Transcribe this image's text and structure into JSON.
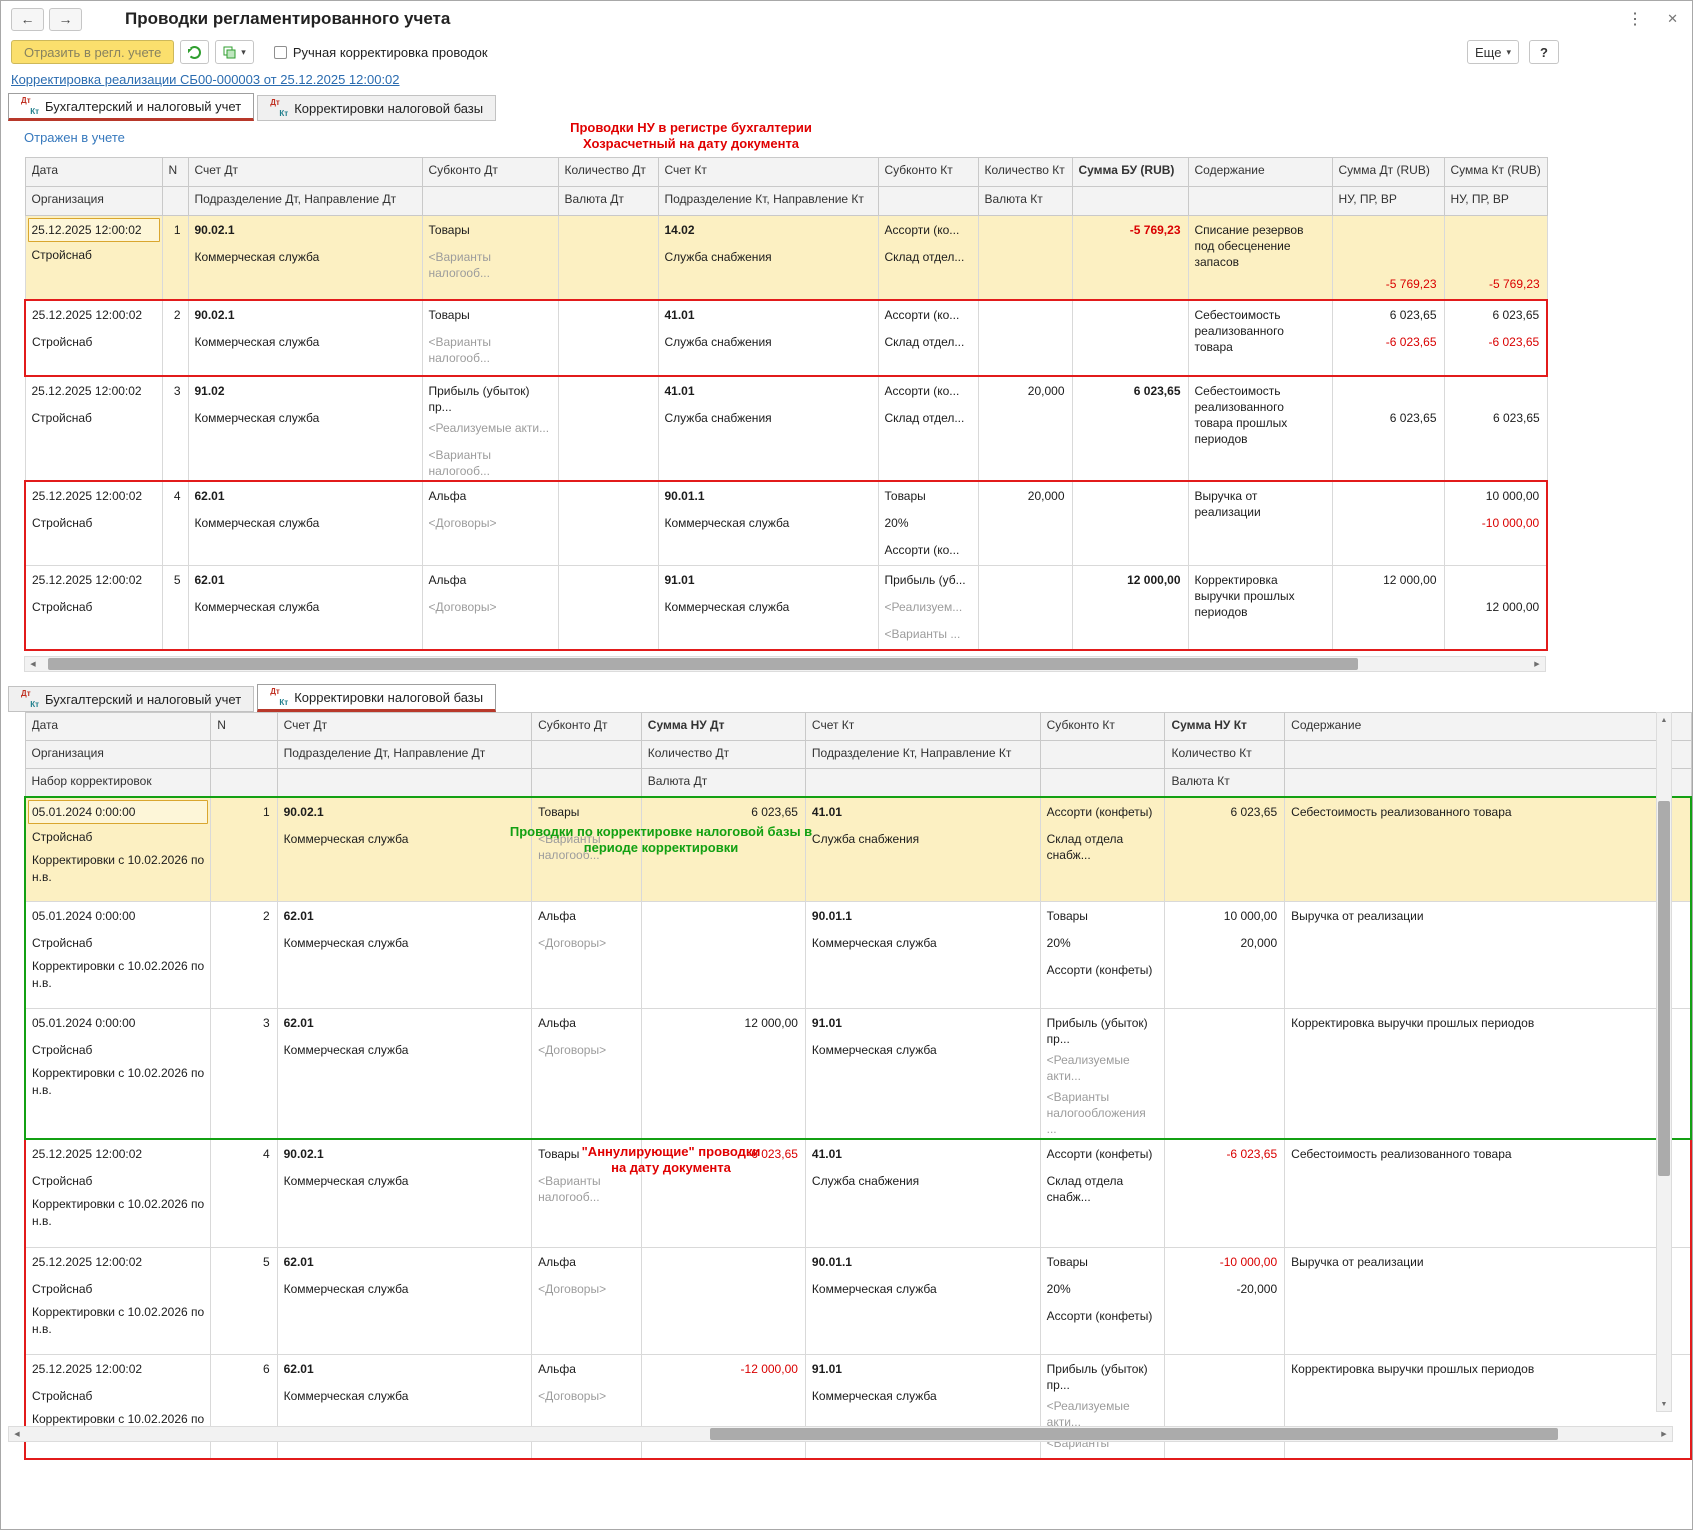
{
  "titlebar": {
    "title": "Проводки регламентированного учета",
    "back": "←",
    "forward": "→"
  },
  "icons": {
    "dots": "⋮",
    "close": "✕",
    "caret": "▾",
    "scroll_left": "◀",
    "scroll_right": "▶",
    "scroll_up": "▲",
    "scroll_down": "▼"
  },
  "toolbar": {
    "reflect_button": "Отразить в регл. учете",
    "manual_correction_label": "Ручная корректировка проводок",
    "manual_correction_checked": false,
    "more_button": "Еще",
    "help_button": "?"
  },
  "document_link": "Корректировка реализации СБ00-000003 от 25.12.2025 12:00:02",
  "status_link": "Отражен в учете",
  "tabs": {
    "bu_nu": "Бухгалтерский и налоговый учет",
    "corrections": "Корректировки налоговой базы"
  },
  "annotations": {
    "top_red_line1": "Проводки НУ в регистре бухгалтерии",
    "top_red_line2": "Хозрасчетный на дату документа",
    "green_line1": "Проводки по корректировке налоговой базы в",
    "green_line2": "периоде корректировки",
    "bottom_red_line1": "\"Аннулирующие\" проводки",
    "bottom_red_line2": "на дату документа"
  },
  "table1": {
    "header": [
      [
        [
          "Дата"
        ],
        [
          "N"
        ],
        [
          "Счет Дт"
        ],
        [
          "Субконто Дт"
        ],
        [
          "Количество Дт"
        ],
        [
          "Счет Кт"
        ],
        [
          "Субконто Кт"
        ],
        [
          "Количество Кт"
        ],
        [
          "Сумма БУ (RUB)",
          "bold"
        ],
        [
          "Содержание"
        ],
        [
          "Сумма Дт (RUB)"
        ],
        [
          "Сумма Кт (RUB)"
        ]
      ],
      [
        [
          "Организация"
        ],
        [
          ""
        ],
        [
          "Подразделение Дт, Направление Дт"
        ],
        [
          ""
        ],
        [
          "Валюта Дт"
        ],
        [
          "Подразделение Кт, Направление Кт"
        ],
        [
          ""
        ],
        [
          "Валюта Кт"
        ],
        [
          ""
        ],
        [
          ""
        ],
        [
          "НУ, ПР, ВР"
        ],
        [
          "НУ, ПР, ВР"
        ]
      ]
    ],
    "rows": [
      {
        "hl": true,
        "frame": "",
        "cells": [
          [
            [
              "25.12.2025 12:00:02",
              "focus"
            ],
            [
              "Стройснаб"
            ]
          ],
          [
            [
              "1",
              "num"
            ]
          ],
          [
            [
              "90.02.1",
              "bold"
            ],
            [
              "Коммерческая служба"
            ]
          ],
          [
            [
              "Товары"
            ],
            [
              "<Варианты налогооб...",
              "gray"
            ]
          ],
          [],
          [
            [
              "14.02",
              "bold"
            ],
            [
              "Служба снабжения"
            ]
          ],
          [
            [
              "Ассорти (ко..."
            ],
            [
              "Склад отдел..."
            ]
          ],
          [],
          [
            [
              "-5 769,23",
              "num red bold"
            ]
          ],
          [
            [
              "Списание резервов под обесценение запасов"
            ]
          ],
          [
            [
              ""
            ],
            [
              ""
            ],
            [
              "-5 769,23",
              "num red"
            ]
          ],
          [
            [
              ""
            ],
            [
              ""
            ],
            [
              "-5 769,23",
              "num red"
            ]
          ]
        ]
      },
      {
        "hl": false,
        "frame": "red",
        "cells": [
          [
            [
              "25.12.2025 12:00:02"
            ],
            [
              "Стройснаб"
            ]
          ],
          [
            [
              "2",
              "num"
            ]
          ],
          [
            [
              "90.02.1",
              "bold"
            ],
            [
              "Коммерческая служба"
            ]
          ],
          [
            [
              "Товары"
            ],
            [
              "<Варианты налогооб...",
              "gray"
            ]
          ],
          [],
          [
            [
              "41.01",
              "bold"
            ],
            [
              "Служба снабжения"
            ]
          ],
          [
            [
              "Ассорти (ко..."
            ],
            [
              "Склад отдел..."
            ]
          ],
          [],
          [],
          [
            [
              "Себестоимость реализованного товара"
            ]
          ],
          [
            [
              "6 023,65",
              "num"
            ],
            [
              "-6 023,65",
              "num red"
            ]
          ],
          [
            [
              "6 023,65",
              "num"
            ],
            [
              "-6 023,65",
              "num red"
            ]
          ]
        ]
      },
      {
        "hl": false,
        "frame": "",
        "cells": [
          [
            [
              "25.12.2025 12:00:02"
            ],
            [
              "Стройснаб"
            ]
          ],
          [
            [
              "3",
              "num"
            ]
          ],
          [
            [
              "91.02",
              "bold"
            ],
            [
              "Коммерческая служба"
            ]
          ],
          [
            [
              "Прибыль (убыток) пр..."
            ],
            [
              "<Реализуемые акти...",
              "gray"
            ],
            [
              "<Варианты налогооб...",
              "gray"
            ]
          ],
          [],
          [
            [
              "41.01",
              "bold"
            ],
            [
              "Служба снабжения"
            ]
          ],
          [
            [
              "Ассорти (ко..."
            ],
            [
              "Склад отдел..."
            ]
          ],
          [
            [
              "20,000",
              "num"
            ]
          ],
          [
            [
              "6 023,65",
              "num bold"
            ]
          ],
          [
            [
              "Себестоимость реализованного товара прошлых периодов"
            ]
          ],
          [
            [
              ""
            ],
            [
              "6 023,65",
              "num"
            ]
          ],
          [
            [
              ""
            ],
            [
              "6 023,65",
              "num"
            ]
          ]
        ]
      },
      {
        "hl": false,
        "frame": "red",
        "cells": [
          [
            [
              "25.12.2025 12:00:02"
            ],
            [
              "Стройснаб"
            ]
          ],
          [
            [
              "4",
              "num"
            ]
          ],
          [
            [
              "62.01",
              "bold"
            ],
            [
              "Коммерческая служба"
            ]
          ],
          [
            [
              "Альфа"
            ],
            [
              "<Договоры>",
              "gray"
            ]
          ],
          [],
          [
            [
              "90.01.1",
              "bold"
            ],
            [
              "Коммерческая служба"
            ]
          ],
          [
            [
              "Товары"
            ],
            [
              "20%"
            ],
            [
              "Ассорти (ко..."
            ]
          ],
          [
            [
              "20,000",
              "num"
            ]
          ],
          [],
          [
            [
              "Выручка от реализации"
            ]
          ],
          [],
          [
            [
              "10 000,00",
              "num"
            ],
            [
              "-10 000,00",
              "num red"
            ]
          ]
        ]
      },
      {
        "hl": false,
        "frame": "red",
        "cells": [
          [
            [
              "25.12.2025 12:00:02"
            ],
            [
              "Стройснаб"
            ]
          ],
          [
            [
              "5",
              "num"
            ]
          ],
          [
            [
              "62.01",
              "bold"
            ],
            [
              "Коммерческая служба"
            ]
          ],
          [
            [
              "Альфа"
            ],
            [
              "<Договоры>",
              "gray"
            ]
          ],
          [],
          [
            [
              "91.01",
              "bold"
            ],
            [
              "Коммерческая служба"
            ]
          ],
          [
            [
              "Прибыль (уб..."
            ],
            [
              "<Реализуем...",
              "gray"
            ],
            [
              "<Варианты ...",
              "gray"
            ]
          ],
          [],
          [
            [
              "12 000,00",
              "num bold"
            ]
          ],
          [
            [
              "Корректировка выручки прошлых периодов"
            ]
          ],
          [
            [
              "12 000,00",
              "num"
            ]
          ],
          [
            [
              ""
            ],
            [
              "12 000,00",
              "num"
            ]
          ]
        ]
      }
    ]
  },
  "table2": {
    "header": [
      [
        [
          "Дата"
        ],
        [
          "N"
        ],
        [
          "Счет Дт"
        ],
        [
          "Субконто Дт"
        ],
        [
          "Сумма НУ Дт",
          "bold"
        ],
        [
          "Счет Кт"
        ],
        [
          "Субконто Кт"
        ],
        [
          "Сумма НУ Кт",
          "bold"
        ],
        [
          "Содержание"
        ]
      ],
      [
        [
          "Организация"
        ],
        [
          ""
        ],
        [
          "Подразделение Дт, Направление Дт"
        ],
        [
          ""
        ],
        [
          "Количество Дт"
        ],
        [
          "Подразделение Кт, Направление Кт"
        ],
        [
          ""
        ],
        [
          "Количество Кт"
        ],
        [
          ""
        ]
      ],
      [
        [
          "Набор корректировок"
        ],
        [
          ""
        ],
        [
          ""
        ],
        [
          ""
        ],
        [
          "Валюта Дт"
        ],
        [
          ""
        ],
        [
          ""
        ],
        [
          "Валюта Кт"
        ],
        [
          ""
        ]
      ]
    ],
    "rows": [
      {
        "hl": true,
        "frame": "green",
        "cells": [
          [
            [
              "05.01.2024 0:00:00",
              "focus"
            ],
            [
              "Стройснаб"
            ],
            [
              "Корректировки с 10.02.2026 по",
              "w"
            ],
            [
              "н.в.",
              "w"
            ]
          ],
          [
            [
              "1",
              "num"
            ]
          ],
          [
            [
              "90.02.1",
              "bold"
            ],
            [
              "Коммерческая служба"
            ]
          ],
          [
            [
              "Товары"
            ],
            [
              "<Варианты налогооб...",
              "gray"
            ]
          ],
          [
            [
              "6 023,65",
              "num"
            ]
          ],
          [
            [
              "41.01",
              "bold"
            ],
            [
              "Служба снабжения"
            ]
          ],
          [
            [
              "Ассорти (конфеты)"
            ],
            [
              "Склад отдела снабж..."
            ]
          ],
          [
            [
              "6 023,65",
              "num"
            ]
          ],
          [
            [
              "Себестоимость реализованного товара"
            ]
          ]
        ]
      },
      {
        "hl": false,
        "frame": "green",
        "cells": [
          [
            [
              "05.01.2024 0:00:00"
            ],
            [
              "Стройснаб"
            ],
            [
              "Корректировки с 10.02.2026 по",
              "w"
            ],
            [
              "н.в.",
              "w"
            ]
          ],
          [
            [
              "2",
              "num"
            ]
          ],
          [
            [
              "62.01",
              "bold"
            ],
            [
              "Коммерческая служба"
            ]
          ],
          [
            [
              "Альфа"
            ],
            [
              "<Договоры>",
              "gray"
            ]
          ],
          [],
          [
            [
              "90.01.1",
              "bold"
            ],
            [
              "Коммерческая служба"
            ]
          ],
          [
            [
              "Товары"
            ],
            [
              "20%"
            ],
            [
              "Ассорти (конфеты)"
            ]
          ],
          [
            [
              "10 000,00",
              "num"
            ],
            [
              "20,000",
              "num"
            ]
          ],
          [
            [
              "Выручка от реализации"
            ]
          ]
        ]
      },
      {
        "hl": false,
        "frame": "green",
        "cells": [
          [
            [
              "05.01.2024 0:00:00"
            ],
            [
              "Стройснаб"
            ],
            [
              "Корректировки с 10.02.2026 по",
              "w"
            ],
            [
              "н.в.",
              "w"
            ]
          ],
          [
            [
              "3",
              "num"
            ]
          ],
          [
            [
              "62.01",
              "bold"
            ],
            [
              "Коммерческая служба"
            ]
          ],
          [
            [
              "Альфа"
            ],
            [
              "<Договоры>",
              "gray"
            ]
          ],
          [
            [
              "12 000,00",
              "num"
            ]
          ],
          [
            [
              "91.01",
              "bold"
            ],
            [
              "Коммерческая служба"
            ]
          ],
          [
            [
              "Прибыль (убыток) пр..."
            ],
            [
              "<Реализуемые акти...",
              "gray"
            ],
            [
              "<Варианты налогообложения ...",
              "gray"
            ]
          ],
          [],
          [
            [
              "Корректировка выручки прошлых периодов"
            ]
          ]
        ]
      },
      {
        "hl": false,
        "frame": "red",
        "cells": [
          [
            [
              "25.12.2025 12:00:02"
            ],
            [
              "Стройснаб"
            ],
            [
              "Корректировки с 10.02.2026 по",
              "w"
            ],
            [
              "н.в.",
              "w"
            ]
          ],
          [
            [
              "4",
              "num"
            ]
          ],
          [
            [
              "90.02.1",
              "bold"
            ],
            [
              "Коммерческая служба"
            ]
          ],
          [
            [
              "Товары"
            ],
            [
              "<Варианты налогооб...",
              "gray"
            ]
          ],
          [
            [
              "-6 023,65",
              "num red"
            ]
          ],
          [
            [
              "41.01",
              "bold"
            ],
            [
              "Служба снабжения"
            ]
          ],
          [
            [
              "Ассорти (конфеты)"
            ],
            [
              "Склад отдела снабж..."
            ]
          ],
          [
            [
              "-6 023,65",
              "num red"
            ]
          ],
          [
            [
              "Себестоимость реализованного товара"
            ]
          ]
        ]
      },
      {
        "hl": false,
        "frame": "red",
        "cells": [
          [
            [
              "25.12.2025 12:00:02"
            ],
            [
              "Стройснаб"
            ],
            [
              "Корректировки с 10.02.2026 по",
              "w"
            ],
            [
              "н.в.",
              "w"
            ]
          ],
          [
            [
              "5",
              "num"
            ]
          ],
          [
            [
              "62.01",
              "bold"
            ],
            [
              "Коммерческая служба"
            ]
          ],
          [
            [
              "Альфа"
            ],
            [
              "<Договоры>",
              "gray"
            ]
          ],
          [],
          [
            [
              "90.01.1",
              "bold"
            ],
            [
              "Коммерческая служба"
            ]
          ],
          [
            [
              "Товары"
            ],
            [
              "20%"
            ],
            [
              "Ассорти (конфеты)"
            ]
          ],
          [
            [
              "-10 000,00",
              "num red"
            ],
            [
              "-20,000",
              "num"
            ]
          ],
          [
            [
              "Выручка от реализации"
            ]
          ]
        ]
      },
      {
        "hl": false,
        "frame": "red",
        "cells": [
          [
            [
              "25.12.2025 12:00:02"
            ],
            [
              "Стройснаб"
            ],
            [
              "Корректировки с 10.02.2026 по",
              "w"
            ]
          ],
          [
            [
              "6",
              "num"
            ]
          ],
          [
            [
              "62.01",
              "bold"
            ],
            [
              "Коммерческая служба"
            ]
          ],
          [
            [
              "Альфа"
            ],
            [
              "<Договоры>",
              "gray"
            ]
          ],
          [
            [
              "-12 000,00",
              "num red"
            ]
          ],
          [
            [
              "91.01",
              "bold"
            ],
            [
              "Коммерческая служба"
            ]
          ],
          [
            [
              "Прибыль (убыток) пр..."
            ],
            [
              "<Реализуемые акти...",
              "gray"
            ],
            [
              "<Варианты",
              "gray"
            ]
          ],
          [],
          [
            [
              "Корректировка выручки прошлых периодов"
            ]
          ]
        ]
      }
    ]
  }
}
